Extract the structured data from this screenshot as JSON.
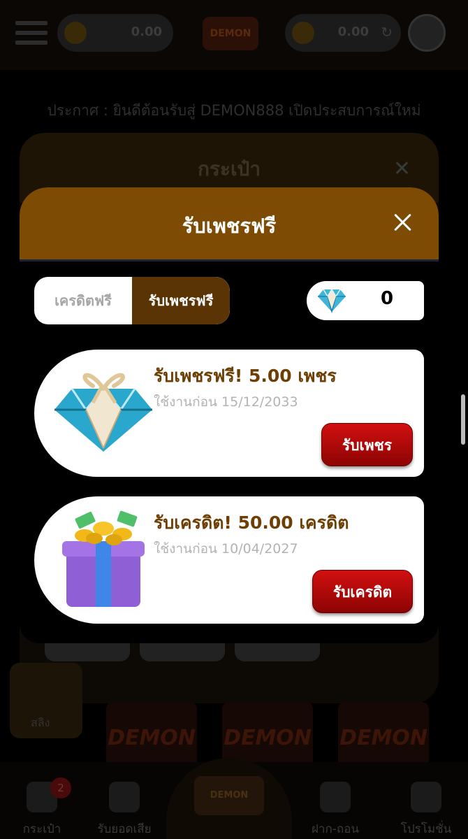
{
  "topbar": {
    "balance_left": "0.00",
    "balance_right": "0.00",
    "logo_text": "DEMON"
  },
  "announcement": "ประกาศ : ยินดีต้อนรับสู่ DEMON888 เปิดประสบการณ์ใหม่",
  "wallet_panel": {
    "title": "กระเป๋า",
    "side_card_label": "สลิง"
  },
  "game_thumbs": [
    "DEMON",
    "DEMON",
    "DEMON"
  ],
  "bottom_nav": {
    "items": [
      {
        "label": "กระเป๋า",
        "icon": "wallet-icon"
      },
      {
        "label": "รับยอดเสีย",
        "icon": "refund-icon"
      },
      {
        "label": "ฝาก-ถอน",
        "icon": "deposit-icon"
      },
      {
        "label": "โปรโมชั่น",
        "icon": "promo-icon"
      }
    ],
    "wallet_badge": "2",
    "center_logo": "DEMON"
  },
  "modal": {
    "title": "รับเพชรฟรี",
    "close_icon": "close-icon",
    "tabs": [
      {
        "label": "เครดิตฟรี",
        "active": false
      },
      {
        "label": "รับเพชรฟรี",
        "active": true
      }
    ],
    "gem_count": "0",
    "rewards": [
      {
        "title": "รับเพชรฟรี! 5.00 เพชร",
        "expiry": "ใช้งานก่อน 15/12/2033",
        "button": "รับเพชร",
        "icon": "diamond-gift-icon"
      },
      {
        "title": "รับเครดิต! 50.00 เครดิต",
        "expiry": "ใช้งานก่อน 10/04/2027",
        "button": "รับเครดิต",
        "icon": "gift-box-coins-icon"
      }
    ]
  },
  "colors": {
    "header_brown": "#7d4b04",
    "tab_active": "#5a3404",
    "title_brown": "#6e3f05",
    "button_red": "#c00a0a"
  }
}
